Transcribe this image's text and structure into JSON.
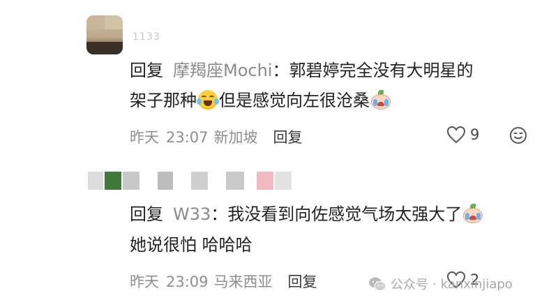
{
  "comment1": {
    "username_fragment": "1133",
    "reply_label": "回复",
    "reply_to_name": "摩羯座Mochi",
    "colon": "：",
    "text_line1": "郭碧婷完全没有大明星的",
    "text_line2_a": "架子那种",
    "text_line2_b": "但是感觉向左很沧桑",
    "time_day": "昨天",
    "time_clock": "23:07",
    "location": "新加坡",
    "reply_button": "回复",
    "like_count": "9"
  },
  "comment2": {
    "reply_label": "回复",
    "reply_to_name": "W33",
    "colon": "：",
    "text_line1": "我没看到向佐感觉气场太强大了",
    "text_line2": "她说很怕 哈哈哈",
    "time_day": "昨天",
    "time_clock": "23:09",
    "location": "马来西亚",
    "reply_button": "回复",
    "like_count": "2"
  },
  "watermark": {
    "platform": "公众号",
    "separator": "·",
    "account": "kanxinjiapo"
  },
  "colors": {
    "mosaic_green": "#3f7a3c",
    "mosaic_pink": "#f4b8c1",
    "mosaic_gray": "#bdbdbd"
  },
  "icons": [
    "heart-icon",
    "emoji-reaction-icon",
    "wechat-icon",
    "laughing-tears-emoji",
    "crying-emoji"
  ]
}
